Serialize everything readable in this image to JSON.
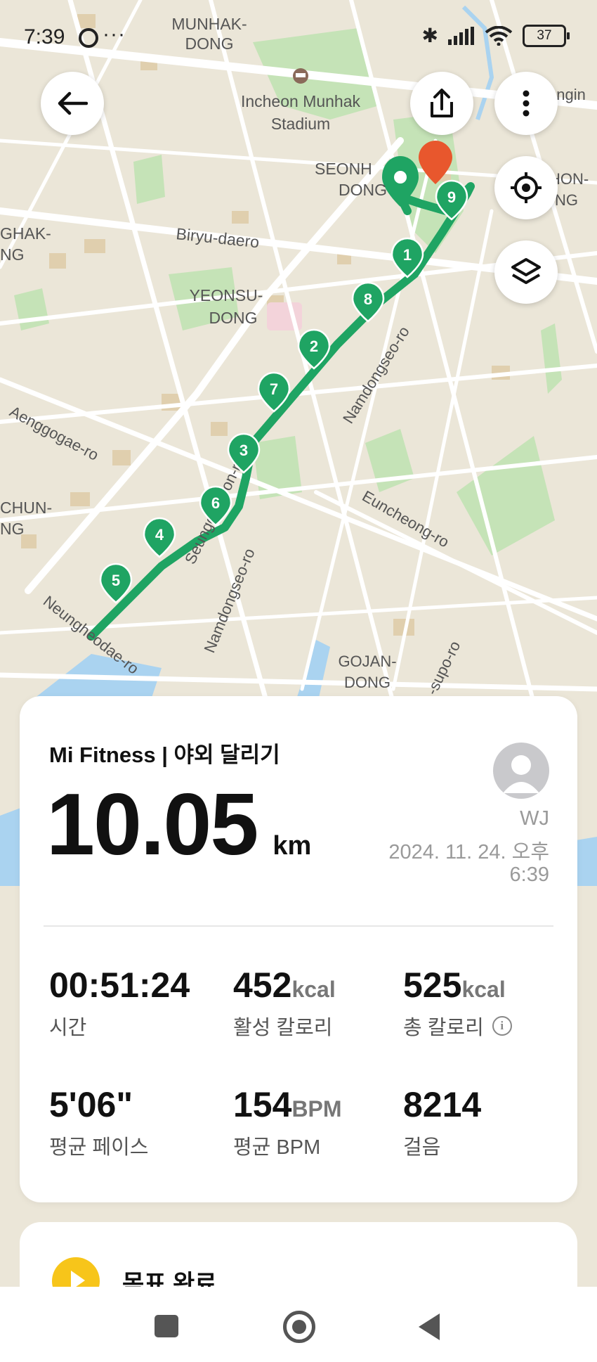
{
  "status_bar": {
    "time": "7:39",
    "dots": "···",
    "bluetooth": "✱",
    "battery": "37"
  },
  "map": {
    "labels": {
      "munhak_dong_1": "MUNHAK-",
      "munhak_dong_2": "DONG",
      "stadium_1": "Incheon Munhak",
      "stadium_2": "Stadium",
      "seonhak_1": "SEONH",
      "seonhak_2": "DONG",
      "biryu": "Biryu-daero",
      "yeonsu_1": "YEONSU-",
      "yeonsu_2": "DONG",
      "ghak_1": "GHAK-",
      "ghak_2": "NG",
      "chun_1": "CHUN-",
      "chun_2": "NG",
      "aenggogae": "Aenggogae-ro",
      "namdongseo_1": "Namdongseo-ro",
      "namdongseo_2": "Namdongseo-ro",
      "seunggicheon": "Seunggicheon-ro",
      "euncheong": "Euncheong-ro",
      "neungheodae": "Neungheodae-ro",
      "gojan_1": "GOJAN-",
      "gojan_2": "DONG",
      "supo": "-supo-ro",
      "ongin": "ongin",
      "hon_1": "HON-",
      "hon_2": "NG"
    },
    "km_markers": [
      "1",
      "2",
      "3",
      "4",
      "5",
      "6",
      "7",
      "8",
      "9"
    ],
    "route_color": "#1fa463"
  },
  "workout": {
    "app_title": "Mi Fitness | 야외 달리기",
    "distance": "10.05",
    "distance_unit": "km",
    "user_name": "WJ",
    "date_line1": "2024. 11. 24. 오후",
    "date_line2": "6:39"
  },
  "stats": {
    "time": {
      "value": "00:51:24",
      "unit": "",
      "label": "시간"
    },
    "active_cal": {
      "value": "452",
      "unit": "kcal",
      "label": "활성 칼로리"
    },
    "total_cal": {
      "value": "525",
      "unit": "kcal",
      "label": "총 칼로리"
    },
    "pace": {
      "value": "5'06\"",
      "unit": "",
      "label": "평균 페이스"
    },
    "bpm": {
      "value": "154",
      "unit": "BPM",
      "label": "평균 BPM"
    },
    "steps": {
      "value": "8214",
      "unit": "",
      "label": "걸음"
    }
  },
  "goal": {
    "label": "목표 완료"
  }
}
